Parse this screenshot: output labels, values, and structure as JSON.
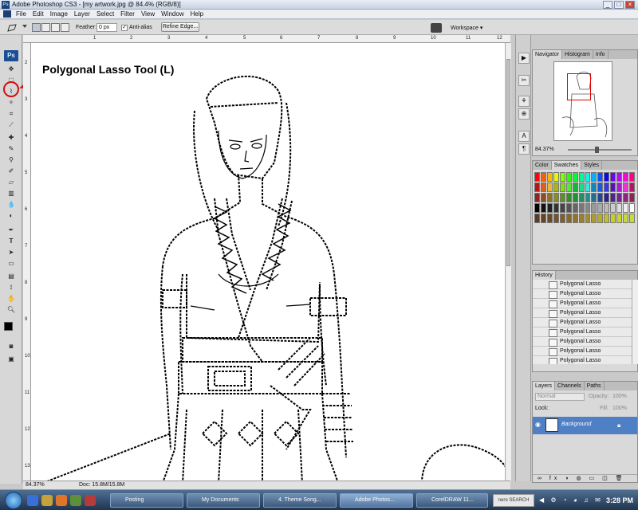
{
  "window": {
    "title": "Adobe Photoshop CS3 - [my artwork.jpg @ 84.4% (RGB/8)]",
    "min": "_",
    "max": "□",
    "close": "×"
  },
  "menu": [
    "File",
    "Edit",
    "Image",
    "Layer",
    "Select",
    "Filter",
    "View",
    "Window",
    "Help"
  ],
  "options": {
    "feather_label": "Feather:",
    "feather_value": "0 px",
    "antialias_label": "Anti-alias",
    "refine_edge": "Refine Edge...",
    "workspace": "Workspace ▾"
  },
  "annotation": "Polygonal Lasso Tool (L)",
  "ruler": {
    "h": [
      "1",
      "2",
      "3",
      "4",
      "5",
      "6",
      "7",
      "8",
      "9",
      "10",
      "11",
      "12"
    ],
    "v": [
      "2",
      "3",
      "4",
      "5",
      "6",
      "7",
      "8",
      "9",
      "10",
      "11",
      "12",
      "13"
    ]
  },
  "status": {
    "zoom": "84.37%",
    "doc": "Doc: 15.8M/15.8M"
  },
  "navigator": {
    "tabs": [
      "Navigator",
      "Histogram",
      "Info"
    ],
    "zoom": "84.37%"
  },
  "swatches": {
    "tabs": [
      "Color",
      "Swatches",
      "Styles"
    ]
  },
  "history": {
    "tab": "History",
    "items": [
      "Polygonal Lasso",
      "Polygonal Lasso",
      "Polygonal Lasso",
      "Polygonal Lasso",
      "Polygonal Lasso",
      "Polygonal Lasso",
      "Polygonal Lasso",
      "Polygonal Lasso",
      "Polygonal Lasso",
      "Polygonal Lasso"
    ]
  },
  "layers": {
    "tabs": [
      "Layers",
      "Channels",
      "Paths"
    ],
    "blend": "Normal",
    "opacity_label": "Opacity:",
    "opacity": "100%",
    "lock_label": "Lock:",
    "fill_label": "Fill:",
    "fill": "100%",
    "layer_name": "Background"
  },
  "taskbar": {
    "items": [
      "Posting",
      "My Documents",
      "4. Theme Song...",
      "Adobe Photos...",
      "CorelDRAW 11..."
    ],
    "search": "nero SEARCH",
    "time": "3:28 PM"
  },
  "colors": {
    "accent": "#1b4f93",
    "annotation_circle": "#d01010"
  }
}
